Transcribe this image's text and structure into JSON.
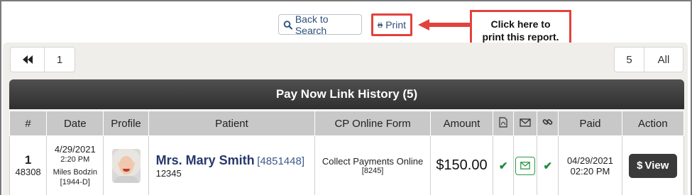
{
  "toolbar": {
    "back_label": "Back to Search",
    "print_label": "Print"
  },
  "callout": {
    "line1": "Click here to",
    "line2": "print this report."
  },
  "pager": {
    "first_glyph": "«",
    "page_1": "1",
    "size_5": "5",
    "size_all": "All"
  },
  "table": {
    "title": "Pay Now Link History (5)",
    "columns": {
      "num": "#",
      "date": "Date",
      "profile": "Profile",
      "patient": "Patient",
      "form": "CP Online Form",
      "amount": "Amount",
      "pdf_icon": "pdf-icon",
      "mail_icon": "envelope-icon",
      "link_icon": "link-icon",
      "paid": "Paid",
      "action": "Action"
    },
    "rows": [
      {
        "num": "1",
        "sub_num": "48308",
        "date": "4/29/2021",
        "time": "2:20 PM",
        "staff": "Miles Bodzin",
        "staff_code": "[1944-D]",
        "patient_name": "Mrs. Mary Smith",
        "patient_id": "[4851448]",
        "patient_sub": "12345",
        "form_name": "Collect Payments Online",
        "form_id": "[8245]",
        "amount": "$150.00",
        "paid_date": "04/29/2021",
        "paid_time": "02:20 PM",
        "action_label": "View"
      }
    ]
  },
  "colors": {
    "accent_red": "#e2423d",
    "link_blue": "#2c4f7c",
    "header_dark": "#3a3a3a",
    "success_green": "#1f8a3a"
  }
}
